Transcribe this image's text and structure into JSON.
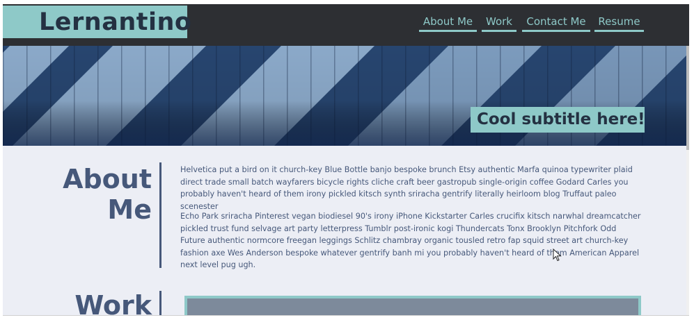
{
  "site": {
    "logo": "Lernantino",
    "nav": [
      "About Me",
      "Work",
      "Contact Me",
      "Resume"
    ]
  },
  "hero": {
    "subtitle": "Cool subtitle here!"
  },
  "about": {
    "title_line1": "About",
    "title_line2": "Me",
    "paragraphs": [
      "Helvetica put a bird on it church-key Blue Bottle banjo bespoke brunch Etsy authentic Marfa quinoa typewriter plaid direct trade small batch wayfarers bicycle rights cliche craft beer gastropub single-origin coffee Godard Carles you probably haven't heard of them irony pickled kitsch synth sriracha gentrify literally heirloom blog Truffaut paleo scenester",
      "Echo Park sriracha Pinterest vegan biodiesel 90's irony iPhone Kickstarter Carles crucifix kitsch narwhal dreamcatcher pickled trust fund selvage art party letterpress Tumblr post-ironic kogi Thundercats Tonx Brooklyn Pitchfork Odd Future authentic normcore freegan leggings Schlitz chambray organic tousled retro fap squid street art church-key fashion axe Wes Anderson bespoke whatever gentrify banh mi you probably haven't heard of them American Apparel next level pug ugh."
    ]
  },
  "work": {
    "title": "Work"
  },
  "colors": {
    "header_bg": "#2d2f33",
    "accent": "#8ec9c8",
    "text": "#46587a",
    "page_bg": "#eceef5"
  },
  "icons": {
    "cursor": "mouse-pointer-icon"
  }
}
